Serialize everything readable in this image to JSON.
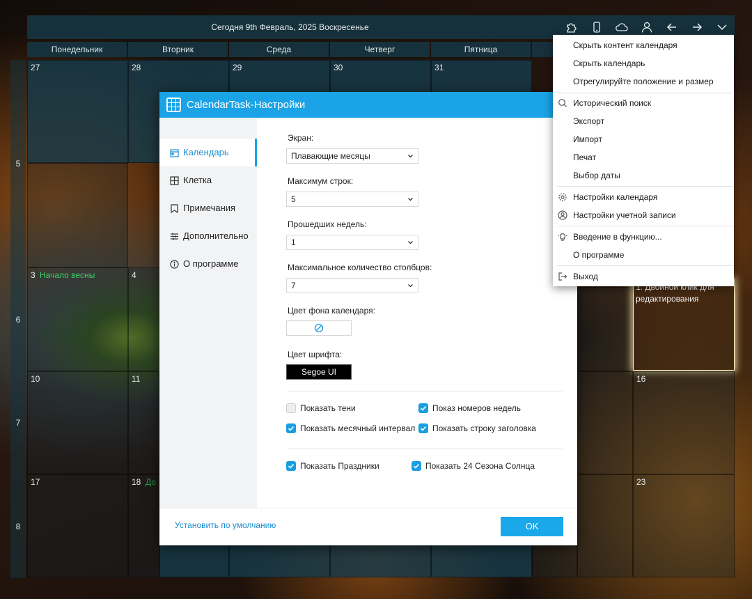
{
  "topbar": {
    "date": "Сегодня 9th Февраль, 2025 Воскресенье",
    "icons": [
      "puzzle-icon",
      "phone-icon",
      "cloud-icon",
      "user-icon",
      "arrow-left-icon",
      "arrow-right-icon",
      "chevron-down-icon"
    ]
  },
  "day_headers": [
    "Понедельник",
    "Вторник",
    "Среда",
    "Четверг",
    "Пятница"
  ],
  "week_numbers": [
    "5",
    "6",
    "7",
    "8"
  ],
  "cells": {
    "r1": [
      "27",
      "28",
      "29",
      "30",
      "31"
    ],
    "r2": {
      "d1": "3",
      "d1_event": "Начало весны",
      "d2": "4",
      "note": "1. Двойной клик для редактирования"
    },
    "r3": {
      "d1": "10",
      "d2": "11",
      "d7": "16"
    },
    "r4": {
      "d1": "17",
      "d2": "18",
      "d2_event": "До",
      "d7": "23"
    }
  },
  "dialog": {
    "title": "CalendarTask-Настройки",
    "sidebar": [
      "Календарь",
      "Клетка",
      "Примечания",
      "Дополнительно",
      "О программе"
    ],
    "fields": {
      "screen_label": "Экран:",
      "screen_value": "Плавающие месяцы",
      "max_rows_label": "Максимум строк:",
      "max_rows_value": "5",
      "past_weeks_label": "Прошедших недель:",
      "past_weeks_value": "1",
      "max_cols_label": "Максимальное количество столбцов:",
      "max_cols_value": "7",
      "bg_color_label": "Цвет фона календаря:",
      "font_color_label": "Цвет шрифта:",
      "font_value": "Segoe UI"
    },
    "checkboxes": {
      "shadows": {
        "label": "Показать тени",
        "checked": false
      },
      "week_numbers": {
        "label": "Показ номеров недель",
        "checked": true
      },
      "month_interval": {
        "label": "Показать месячный интервал",
        "checked": true
      },
      "title_bar": {
        "label": "Показать строку заголовка",
        "checked": true
      },
      "holidays": {
        "label": "Показать Праздники",
        "checked": true
      },
      "solar_terms": {
        "label": "Показать 24 Сезона Солнца",
        "checked": true
      }
    },
    "reset_link": "Установить по умолчанию",
    "ok_label": "OK"
  },
  "menu": [
    "Скрыть контент календаря",
    "Скрыть календарь",
    "Отрегулируйте положение и размер",
    "Исторический поиск",
    "Экспорт",
    "Импорт",
    "Печат",
    "Выбор даты",
    "Настройки календаря",
    "Настройки учетной записи",
    "Введение в функцию...",
    "О программе",
    "Выход"
  ],
  "colors": {
    "accent": "#1aa3e6",
    "event_green": "#3dd06a",
    "cell_bg": "#163a4a"
  }
}
